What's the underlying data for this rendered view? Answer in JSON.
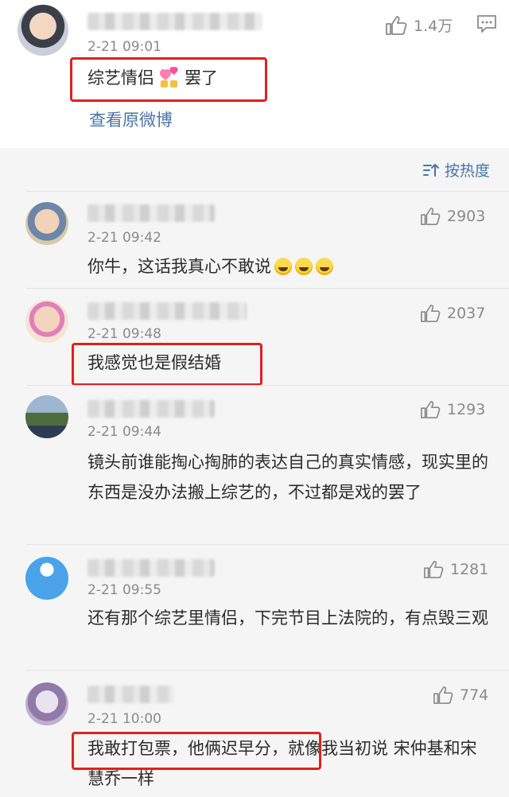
{
  "top_comment": {
    "time": "2-21 09:01",
    "likes": "1.4万",
    "text_before": "综艺情侣",
    "text_after": "罢了",
    "view_original": "查看原微博"
  },
  "sort_label": "按热度",
  "comments": [
    {
      "time": "2-21 09:42",
      "likes": "2903",
      "text": "你牛，这话我真心不敢说"
    },
    {
      "time": "2-21 09:48",
      "likes": "2037",
      "text": "我感觉也是假结婚"
    },
    {
      "time": "2-21 09:44",
      "likes": "1293",
      "text": "镜头前谁能掏心掏肺的表达自己的真实情感，现实里的东西是没办法搬上综艺的，不过都是戏的罢了"
    },
    {
      "time": "2-21 09:55",
      "likes": "1281",
      "text": "还有那个综艺里情侣，下完节目上法院的，有点毁三观"
    },
    {
      "time": "2-21 10:00",
      "likes": "774",
      "text": "我敢打包票，他俩迟早分，就像我当初说 宋仲基和宋慧乔一样"
    }
  ]
}
